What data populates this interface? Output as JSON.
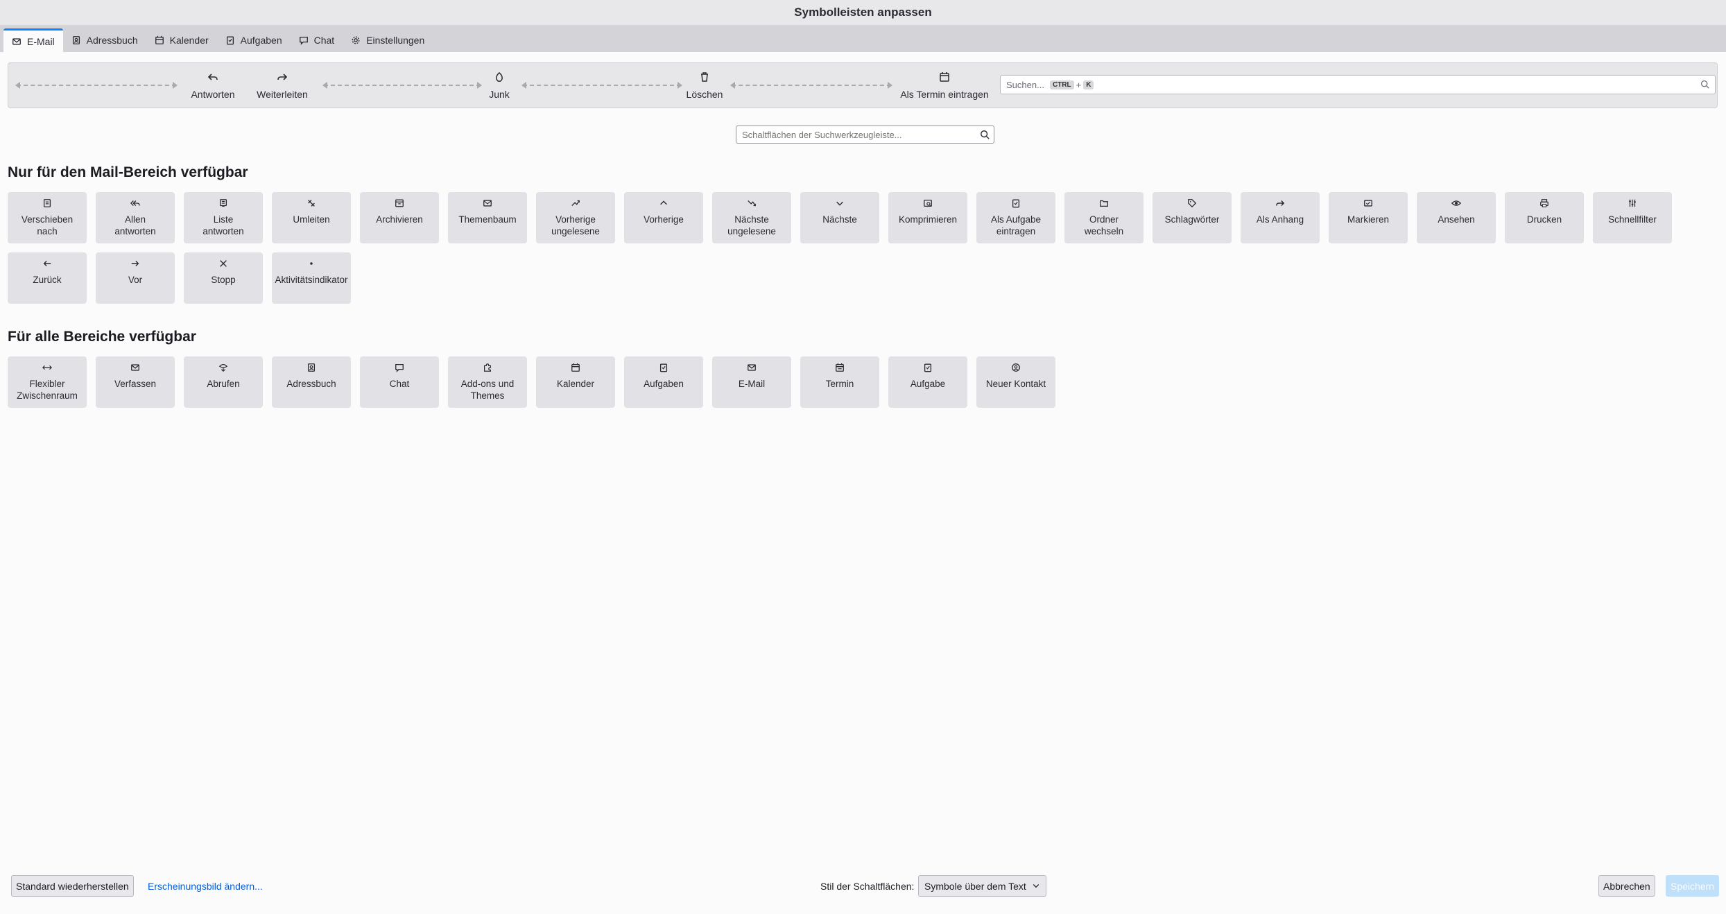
{
  "window": {
    "title": "Symbolleisten anpassen"
  },
  "tabs": [
    {
      "label": "E-Mail",
      "icon": "mail-icon",
      "active": true
    },
    {
      "label": "Adressbuch",
      "icon": "address-book-icon",
      "active": false
    },
    {
      "label": "Kalender",
      "icon": "calendar-icon",
      "active": false
    },
    {
      "label": "Aufgaben",
      "icon": "tasks-icon",
      "active": false
    },
    {
      "label": "Chat",
      "icon": "chat-icon",
      "active": false
    },
    {
      "label": "Einstellungen",
      "icon": "gear-icon",
      "active": false
    }
  ],
  "toolbar_preview": {
    "items": [
      {
        "label": "Antworten",
        "icon": "reply-icon"
      },
      {
        "label": "Weiterleiten",
        "icon": "forward-icon"
      },
      {
        "label": "Junk",
        "icon": "junk-icon"
      },
      {
        "label": "Löschen",
        "icon": "trash-icon"
      },
      {
        "label": "Als Termin eintragen",
        "icon": "calendar-event-icon"
      }
    ],
    "search": {
      "placeholder": "Suchen...",
      "shortcut_key1": "CTRL",
      "shortcut_plus": "+",
      "shortcut_key2": "K"
    }
  },
  "palette_search": {
    "placeholder": "Schaltflächen der Suchwerkzeugleiste..."
  },
  "mail_section": {
    "heading": "Nur für den Mail-Bereich verfügbar",
    "buttons": [
      {
        "label": "Verschieben\nnach",
        "icon": "move-icon"
      },
      {
        "label": "Allen\nantworten",
        "icon": "reply-all-icon"
      },
      {
        "label": "Liste\nantworten",
        "icon": "reply-list-icon"
      },
      {
        "label": "Umleiten",
        "icon": "redirect-icon"
      },
      {
        "label": "Archivieren",
        "icon": "archive-icon"
      },
      {
        "label": "Themenbaum",
        "icon": "threads-icon"
      },
      {
        "label": "Vorherige\nungelesene",
        "icon": "previous-unread-icon"
      },
      {
        "label": "Vorherige",
        "icon": "chevron-up-icon"
      },
      {
        "label": "Nächste\nungelesene",
        "icon": "next-unread-icon"
      },
      {
        "label": "Nächste",
        "icon": "chevron-down-icon"
      },
      {
        "label": "Komprimieren",
        "icon": "compact-icon"
      },
      {
        "label": "Als Aufgabe\neintragen",
        "icon": "add-task-icon"
      },
      {
        "label": "Ordner\nwechseln",
        "icon": "folder-icon"
      },
      {
        "label": "Schlagwörter",
        "icon": "tag-icon"
      },
      {
        "label": "Als Anhang",
        "icon": "forward-attachment-icon"
      },
      {
        "label": "Markieren",
        "icon": "mark-icon"
      },
      {
        "label": "Ansehen",
        "icon": "eye-icon"
      },
      {
        "label": "Drucken",
        "icon": "print-icon"
      },
      {
        "label": "Schnellfilter",
        "icon": "filter-icon"
      },
      {
        "label": "Zurück",
        "icon": "arrow-left-icon"
      },
      {
        "label": "Vor",
        "icon": "arrow-right-icon"
      },
      {
        "label": "Stopp",
        "icon": "close-icon"
      },
      {
        "label": "Aktivitätsindikator",
        "icon": "activity-dot-icon"
      }
    ]
  },
  "all_section": {
    "heading": "Für alle Bereiche verfügbar",
    "buttons": [
      {
        "label": "Flexibler\nZwischenraum",
        "icon": "flexible-space-icon"
      },
      {
        "label": "Verfassen",
        "icon": "compose-icon"
      },
      {
        "label": "Abrufen",
        "icon": "get-messages-icon"
      },
      {
        "label": "Adressbuch",
        "icon": "address-book-icon"
      },
      {
        "label": "Chat",
        "icon": "chat-icon"
      },
      {
        "label": "Add-ons und\nThemes",
        "icon": "addons-icon"
      },
      {
        "label": "Kalender",
        "icon": "calendar-icon"
      },
      {
        "label": "Aufgaben",
        "icon": "tasks-icon"
      },
      {
        "label": "E-Mail",
        "icon": "mail-icon"
      },
      {
        "label": "Termin",
        "icon": "calendar-event-icon"
      },
      {
        "label": "Aufgabe",
        "icon": "add-task-icon"
      },
      {
        "label": "Neuer Kontakt",
        "icon": "new-contact-icon"
      }
    ]
  },
  "footer": {
    "reset_label": "Standard wiederherstellen",
    "appearance_link": "Erscheinungsbild ändern...",
    "style_label": "Stil der Schaltflächen:",
    "style_value": "Symbole über dem Text",
    "cancel_label": "Abbrechen",
    "save_label": "Speichern"
  },
  "colors": {
    "accent": "#0a84ff",
    "link": "#0060df",
    "tile": "#e2e2e6",
    "save_disabled": "#bfe0fb"
  }
}
